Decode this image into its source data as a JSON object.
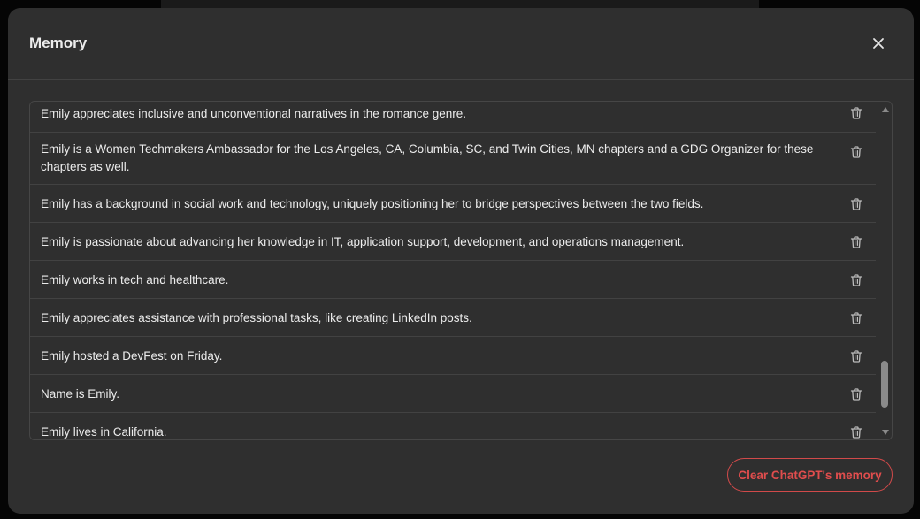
{
  "modal": {
    "title": "Memory",
    "close_icon": "close-icon"
  },
  "memories": [
    {
      "text": "Emily appreciates inclusive and unconventional narratives in the romance genre."
    },
    {
      "text": "Emily is a Women Techmakers Ambassador for the Los Angeles, CA, Columbia, SC, and Twin Cities, MN chapters and a GDG Organizer for these chapters as well."
    },
    {
      "text": "Emily has a background in social work and technology, uniquely positioning her to bridge perspectives between the two fields."
    },
    {
      "text": "Emily is passionate about advancing her knowledge in IT, application support, development, and operations management."
    },
    {
      "text": "Emily works in tech and healthcare."
    },
    {
      "text": "Emily appreciates assistance with professional tasks, like creating LinkedIn posts."
    },
    {
      "text": "Emily hosted a DevFest on Friday."
    },
    {
      "text": "Name is Emily."
    },
    {
      "text": "Emily lives in California."
    }
  ],
  "row_icon": "trash-icon",
  "clear_button": {
    "label": "Clear ChatGPT's memory"
  },
  "colors": {
    "modal_background": "#2f2f2f",
    "text": "#ececec",
    "divider": "#424242",
    "danger": "#e04d4d"
  }
}
